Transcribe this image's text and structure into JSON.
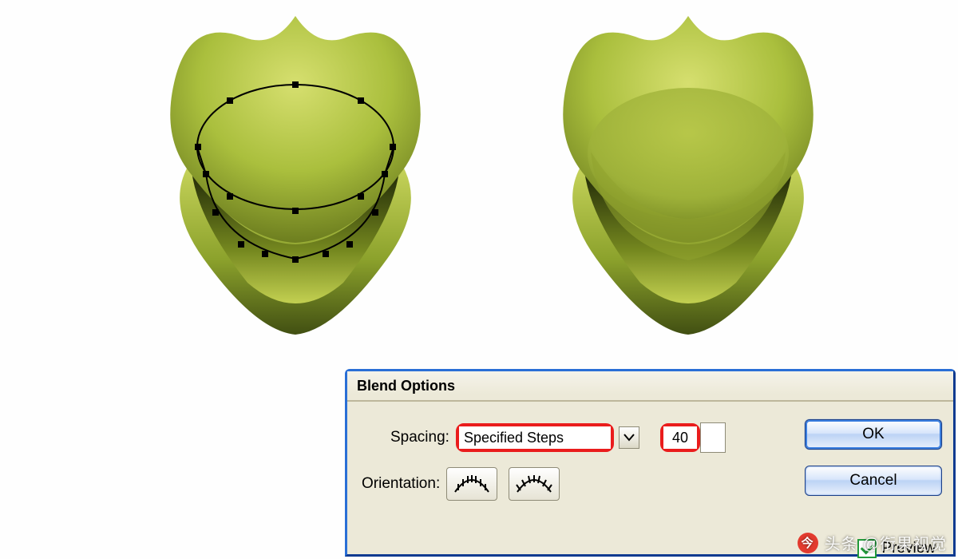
{
  "dialog": {
    "title": "Blend Options",
    "spacing_label": "Spacing:",
    "spacing_value": "Specified Steps",
    "steps_value": "40",
    "orientation_label": "Orientation:",
    "orientation_options": [
      "align-to-page",
      "align-to-path"
    ],
    "ok_label": "OK",
    "cancel_label": "Cancel",
    "preview_label": "Preview",
    "preview_checked": true
  },
  "watermark": {
    "prefix": "头条",
    "handle": "@衔果视觉"
  },
  "colors": {
    "highlight": "#ea1c1c",
    "panel": "#ece9d8",
    "accent": "#2a6fd6",
    "frog_light": "#c9d657",
    "frog_mid": "#9bb037",
    "frog_dark": "#3f4a15"
  }
}
